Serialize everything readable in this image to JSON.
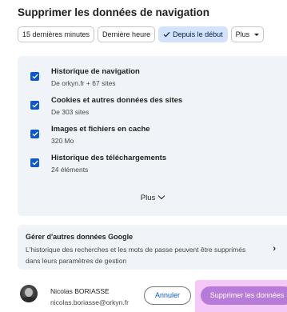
{
  "dialog": {
    "title": "Supprimer les données de navigation"
  },
  "time_ranges": [
    {
      "label": "15 dernières minutes",
      "selected": false
    },
    {
      "label": "Dernière heure",
      "selected": false
    },
    {
      "label": "Depuis le début",
      "selected": true
    },
    {
      "label": "Plus",
      "selected": false
    }
  ],
  "data_types": [
    {
      "title": "Historique de navigation",
      "detail": "De orkyn.fr + 67 sites",
      "checked": true
    },
    {
      "title": "Cookies et autres données des sites",
      "detail": "De 303 sites",
      "checked": true
    },
    {
      "title": "Images et fichiers en cache",
      "detail": "320 Mo",
      "checked": true
    },
    {
      "title": "Historique des téléchargements",
      "detail": "24 éléments",
      "checked": true
    }
  ],
  "more_label": "Plus",
  "google_data": {
    "title": "Gérer d'autres données Google",
    "description": "L'historique des recherches et les mots de passe peuvent être supprimés dans leurs paramètres de gestion"
  },
  "account": {
    "name": "Nicolas BORIASSE",
    "email": "nicolas.boriasse@orkyn.fr"
  },
  "actions": {
    "cancel_label": "Annuler",
    "confirm_label": "Supprimer les données"
  },
  "colors": {
    "accent": "#0b57d0",
    "selected_chip": "#d3e3fd",
    "panel_bg": "#f0f4f9",
    "highlight": "#f4c8f7"
  }
}
